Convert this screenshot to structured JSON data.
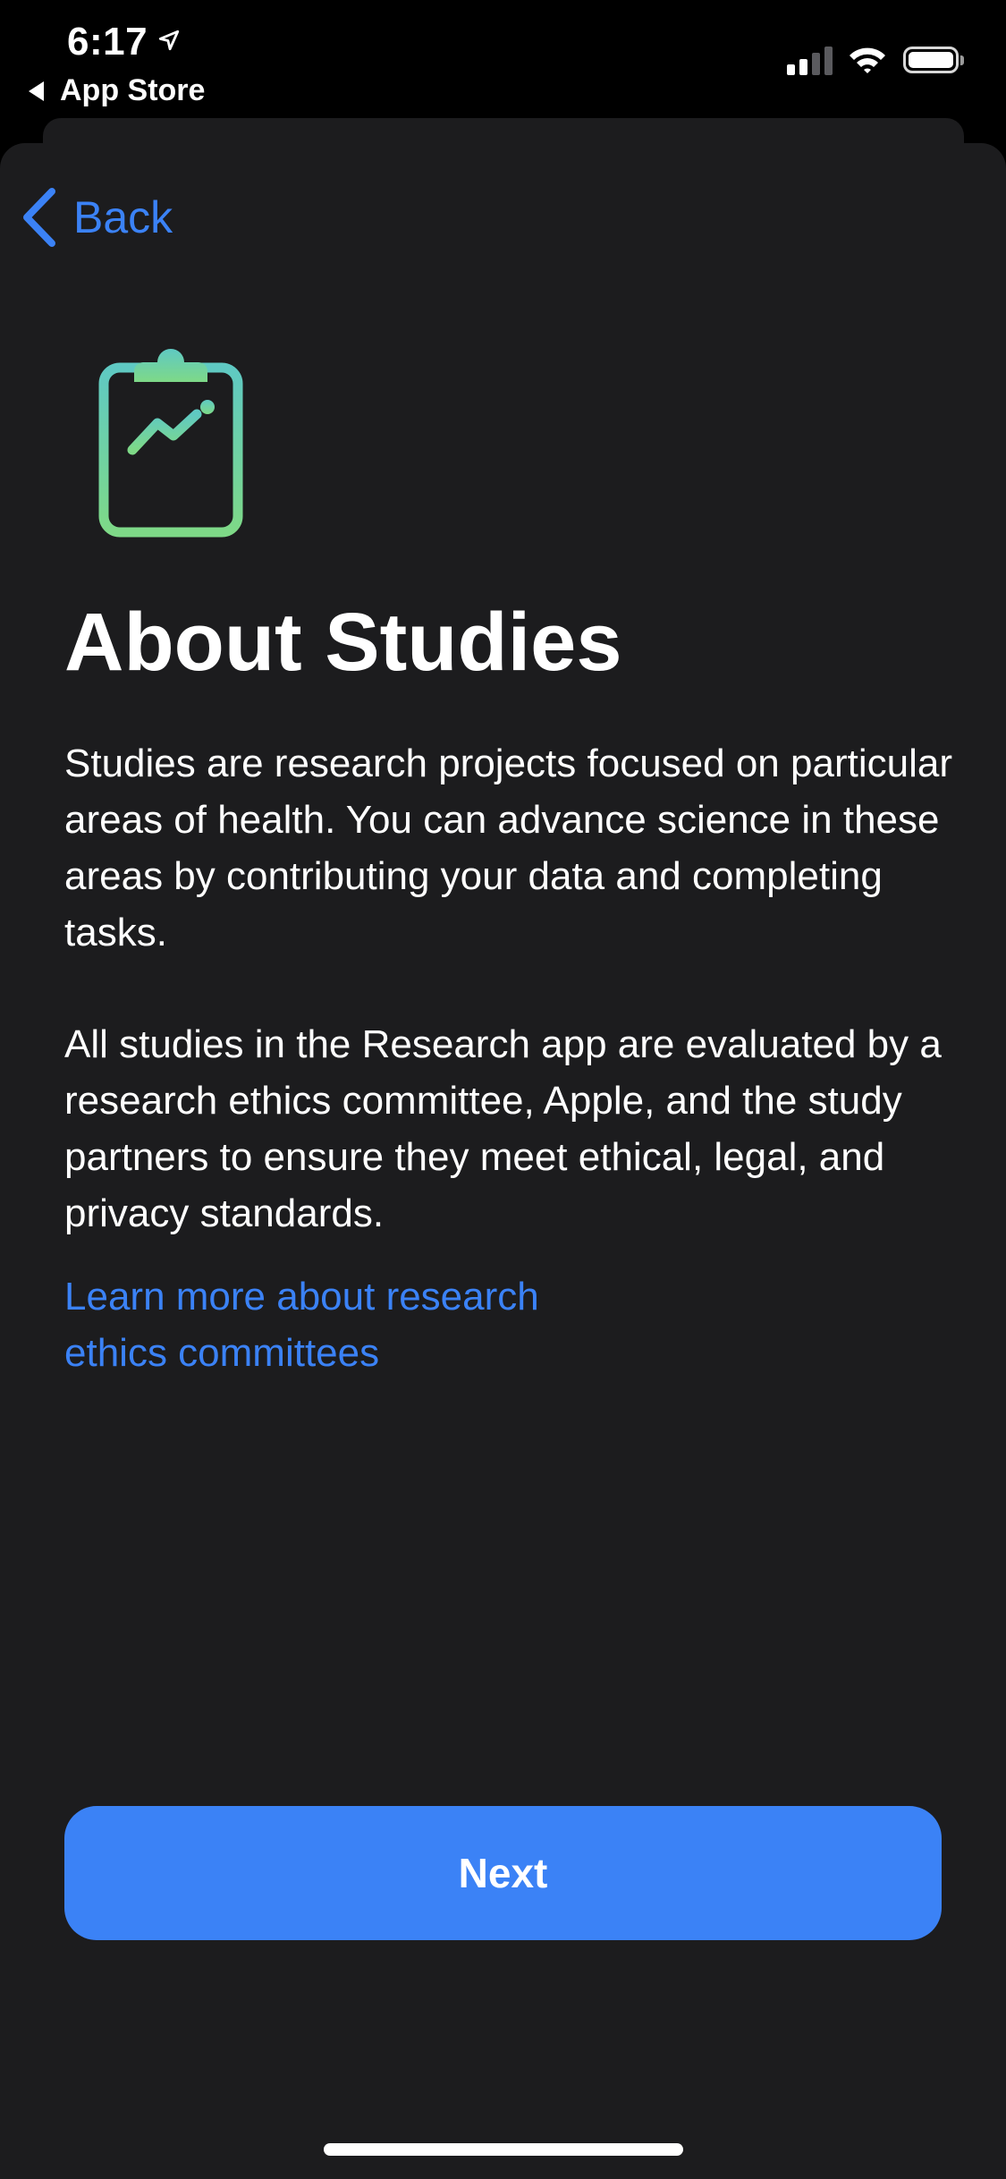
{
  "status_bar": {
    "time": "6:17",
    "back_app_label": "App Store",
    "location_icon": "location-arrow-icon",
    "signal_icon": "cellular-signal-icon",
    "wifi_icon": "wifi-icon",
    "battery_icon": "battery-icon"
  },
  "nav": {
    "back_label": "Back",
    "back_icon": "chevron-left-icon"
  },
  "hero_icon": "clipboard-chart-icon",
  "content": {
    "title": "About Studies",
    "paragraph_1": "Studies are research projects focused on particular areas of health. You can advance science in these areas by contributing your data and completing tasks.",
    "paragraph_2": "All studies in the Research app are evaluated by a research ethics committee, Apple, and the study partners to ensure they meet ethical, legal, and privacy standards.",
    "link_text": "Learn more about research ethics committees"
  },
  "actions": {
    "next_label": "Next"
  },
  "colors": {
    "accent": "#3b82f6",
    "background": "#1c1c1e",
    "icon_gradient_top": "#5fc9c3",
    "icon_gradient_bottom": "#7ed987"
  }
}
